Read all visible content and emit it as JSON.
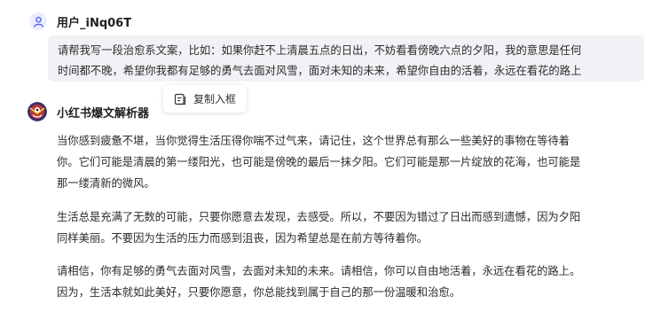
{
  "user": {
    "name": "用户_iNq06T",
    "message_lines": [
      "请帮我写一段治愈系文案，比如：如果你赶不上清晨五点的日出，不妨看看傍晚六点的夕阳，我的意思是任何",
      "时间都不晚，希望你我都有足够的勇气去面对风雪，面对未知的未来，希望你自由的活着，永远在看花的路上"
    ],
    "avatar_icon": "user-icon"
  },
  "copy_action": {
    "label": "复制入框",
    "icon": "copy-icon"
  },
  "bot": {
    "name": "小红书爆文解析器",
    "avatar_icon": "bot-avatar-emblem",
    "paragraphs": [
      {
        "lines": [
          "当你感到疲惫不堪，当你觉得生活压得你喘不过气来，请记住，这个世界总有那么一些美好的事物在等待着",
          "你。它们可能是清晨的第一缕阳光，也可能是傍晚的最后一抹夕阳。它们可能是那一片绽放的花海，也可能是",
          "那一缕清新的微风。"
        ]
      },
      {
        "lines": [
          "生活总是充满了无数的可能，只要你愿意去发现，去感受。所以，不要因为错过了日出而感到遗憾，因为夕阳",
          "同样美丽。不要因为生活的压力而感到沮丧，因为希望总是在前方等待着你。"
        ]
      },
      {
        "lines": [
          "请相信，你有足够的勇气去面对风雪，去面对未知的未来。请相信，你可以自由地活着，永远在看花的路上。",
          "因为，生活本就如此美好，只要你愿意，你总能找到属于自己的那一份温暖和治愈。"
        ]
      }
    ]
  },
  "colors": {
    "bubble_bg": "#f1f2f5",
    "user_avatar_bg": "#eceeff",
    "user_avatar_icon": "#4e5bf5",
    "text": "#2b2b2b"
  }
}
